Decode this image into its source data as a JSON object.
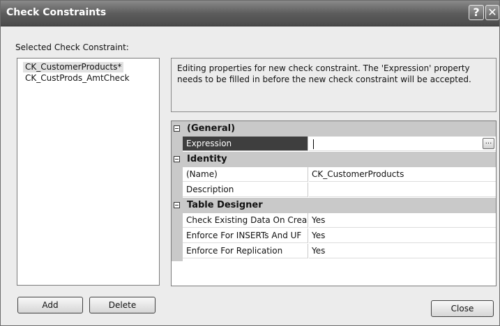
{
  "window": {
    "title": "Check Constraints",
    "help_glyph": "?",
    "close_glyph": "✕"
  },
  "selected_label": "Selected Check Constraint:",
  "constraints": [
    {
      "label": "CK_CustomerProducts*",
      "selected": true
    },
    {
      "label": "CK_CustProds_AmtCheck",
      "selected": false
    }
  ],
  "description": "Editing properties for new check constraint.  The 'Expression' property needs to be filled in before the new check constraint will be accepted.",
  "properties": {
    "general": {
      "category": "(General)",
      "expression": {
        "name": "Expression",
        "value": "",
        "button": "..."
      }
    },
    "identity": {
      "category": "Identity",
      "name": {
        "name": "(Name)",
        "value": "CK_CustomerProducts"
      },
      "description": {
        "name": "Description",
        "value": ""
      }
    },
    "table_designer": {
      "category": "Table Designer",
      "check_existing": {
        "name": "Check Existing Data On Crea",
        "value": "Yes"
      },
      "enforce_inserts": {
        "name": "Enforce For INSERTs And UF",
        "value": "Yes"
      },
      "enforce_replication": {
        "name": "Enforce For Replication",
        "value": "Yes"
      }
    }
  },
  "buttons": {
    "add": "Add",
    "delete": "Delete",
    "close": "Close"
  }
}
